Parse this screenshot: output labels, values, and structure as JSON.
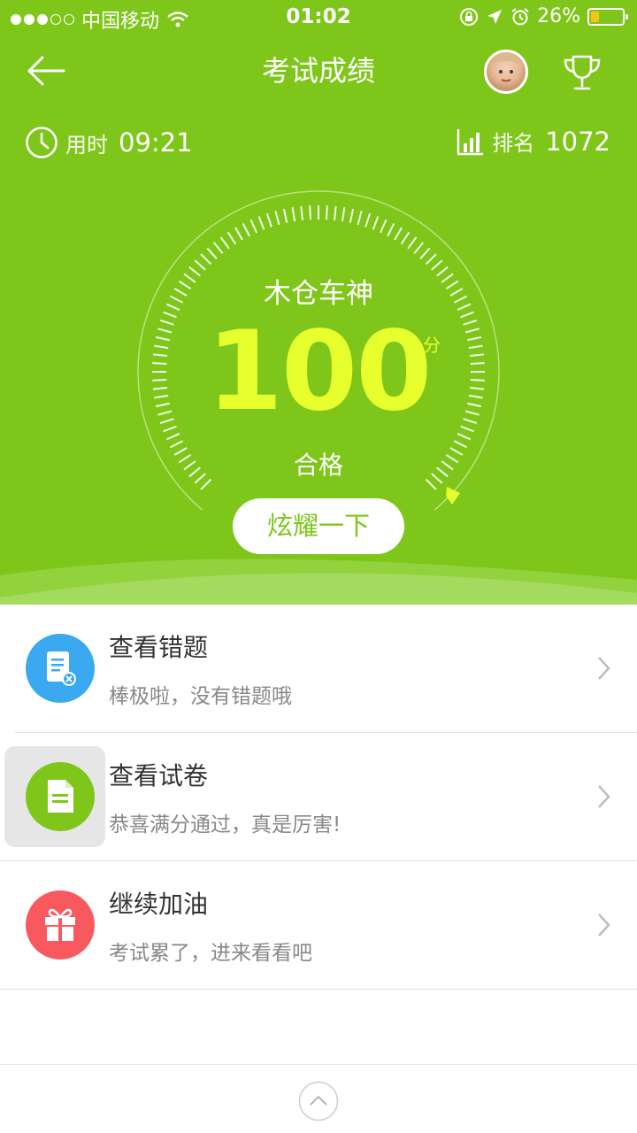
{
  "status_bar": {
    "carrier": "中国移动",
    "time": "01:02",
    "battery": "26%",
    "battery_level": 0.26
  },
  "header": {
    "title": "考试成绩"
  },
  "info": {
    "time_label": "用时",
    "time_value": "09:21",
    "rank_label": "排名",
    "rank_value": "1072"
  },
  "result": {
    "name": "木仓车神",
    "score": "100",
    "unit": "分",
    "status": "合格",
    "share_button": "炫耀一下"
  },
  "list": [
    {
      "title": "查看错题",
      "subtitle": "棒极啦，没有错题哦",
      "color": "#3aa9ef",
      "icon": "wrong-questions-icon"
    },
    {
      "title": "查看试卷",
      "subtitle": "恭喜满分通过，真是厉害!",
      "color": "#7ec61a",
      "icon": "exam-paper-icon"
    },
    {
      "title": "继续加油",
      "subtitle": "考试累了，进来看看吧",
      "color": "#f8595f",
      "icon": "gift-icon"
    }
  ],
  "colors": {
    "primary": "#7ec61a",
    "score": "#e8ff2e"
  }
}
